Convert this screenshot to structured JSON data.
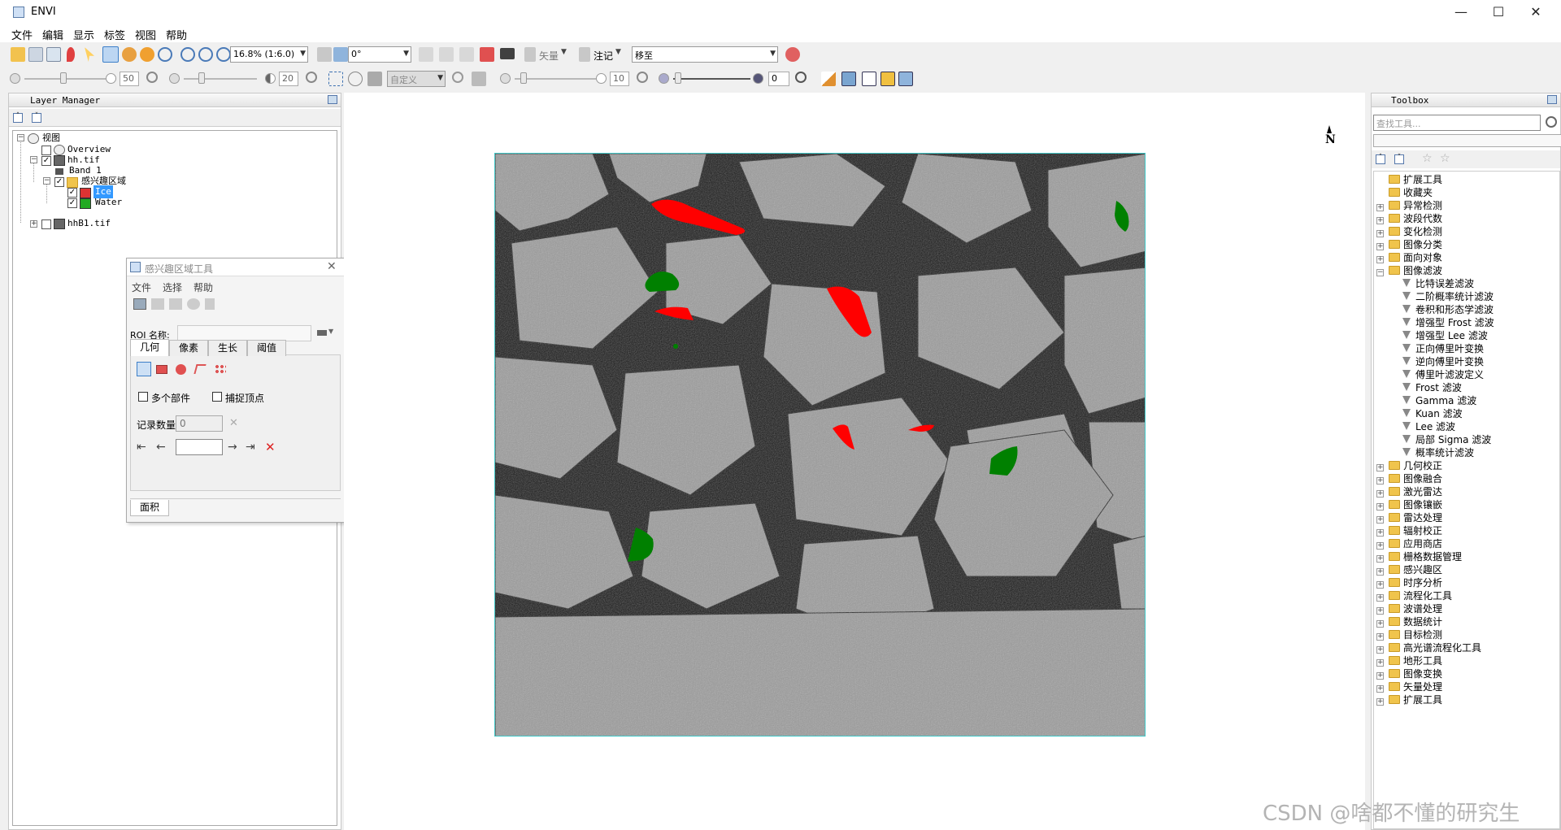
{
  "window": {
    "title": "ENVI",
    "minimize": "—",
    "maximize": "☐",
    "close": "✕"
  },
  "menu": [
    "文件",
    "编辑",
    "显示",
    "标签",
    "视图",
    "帮助"
  ],
  "toolbar1": {
    "zoom": "16.8% (1:6.0)",
    "rotation": "0°",
    "vector": "矢量",
    "annotation": "注记",
    "goto": "移至"
  },
  "toolbar2": {
    "brightness": "50",
    "contrast": "20",
    "stretch": "自定义",
    "sharpen": "10",
    "transparency": "0"
  },
  "layer_manager": {
    "title": "Layer Manager",
    "items": {
      "view": "视图",
      "overview": "Overview",
      "hh": "hh.tif",
      "band": "Band 1",
      "roi_group": "感兴趣区域",
      "ice": "Ice",
      "water": "Water",
      "hhb1": "hhB1.tif"
    }
  },
  "roi_tool": {
    "title": "感兴趣区域工具",
    "menu": [
      "文件",
      "选择",
      "帮助"
    ],
    "name_label": "ROI 名称:",
    "tabs": [
      "几何",
      "像素",
      "生长",
      "阈值"
    ],
    "multi_part": "多个部件",
    "snap_vertex": "捕捉顶点",
    "record_count_label": "记录数量",
    "record_count": "0",
    "bottom_tab": "面积"
  },
  "toolbox": {
    "title": "Toolbox",
    "search_placeholder": "查找工具...",
    "top": [
      "扩展工具",
      "收藏夹"
    ],
    "folders_a": [
      "异常检测",
      "波段代数",
      "变化检测",
      "图像分类",
      "面向对象"
    ],
    "expanded": "图像滤波",
    "filters": [
      "比特误差滤波",
      "二阶概率统计滤波",
      "卷积和形态学滤波",
      "增强型 Frost 滤波",
      "增强型 Lee 滤波",
      "正向傅里叶变换",
      "逆向傅里叶变换",
      "傅里叶滤波定义",
      "Frost 滤波",
      "Gamma 滤波",
      "Kuan 滤波",
      "Lee 滤波",
      "局部 Sigma 滤波",
      "概率统计滤波"
    ],
    "folders_b": [
      "几何校正",
      "图像融合",
      "激光雷达",
      "图像镶嵌",
      "雷达处理",
      "辐射校正",
      "应用商店",
      "栅格数据管理",
      "感兴趣区",
      "时序分析",
      "流程化工具",
      "波谱处理",
      "数据统计",
      "目标检测",
      "高光谱流程化工具",
      "地形工具",
      "图像变换",
      "矢量处理",
      "扩展工具"
    ]
  },
  "north_arrow": "N",
  "watermark": "CSDN @啥都不懂的研究生",
  "colors": {
    "ice": "#ff0000",
    "water": "#008000",
    "selection": "#3399ff",
    "image_border": "#41c8c8"
  }
}
